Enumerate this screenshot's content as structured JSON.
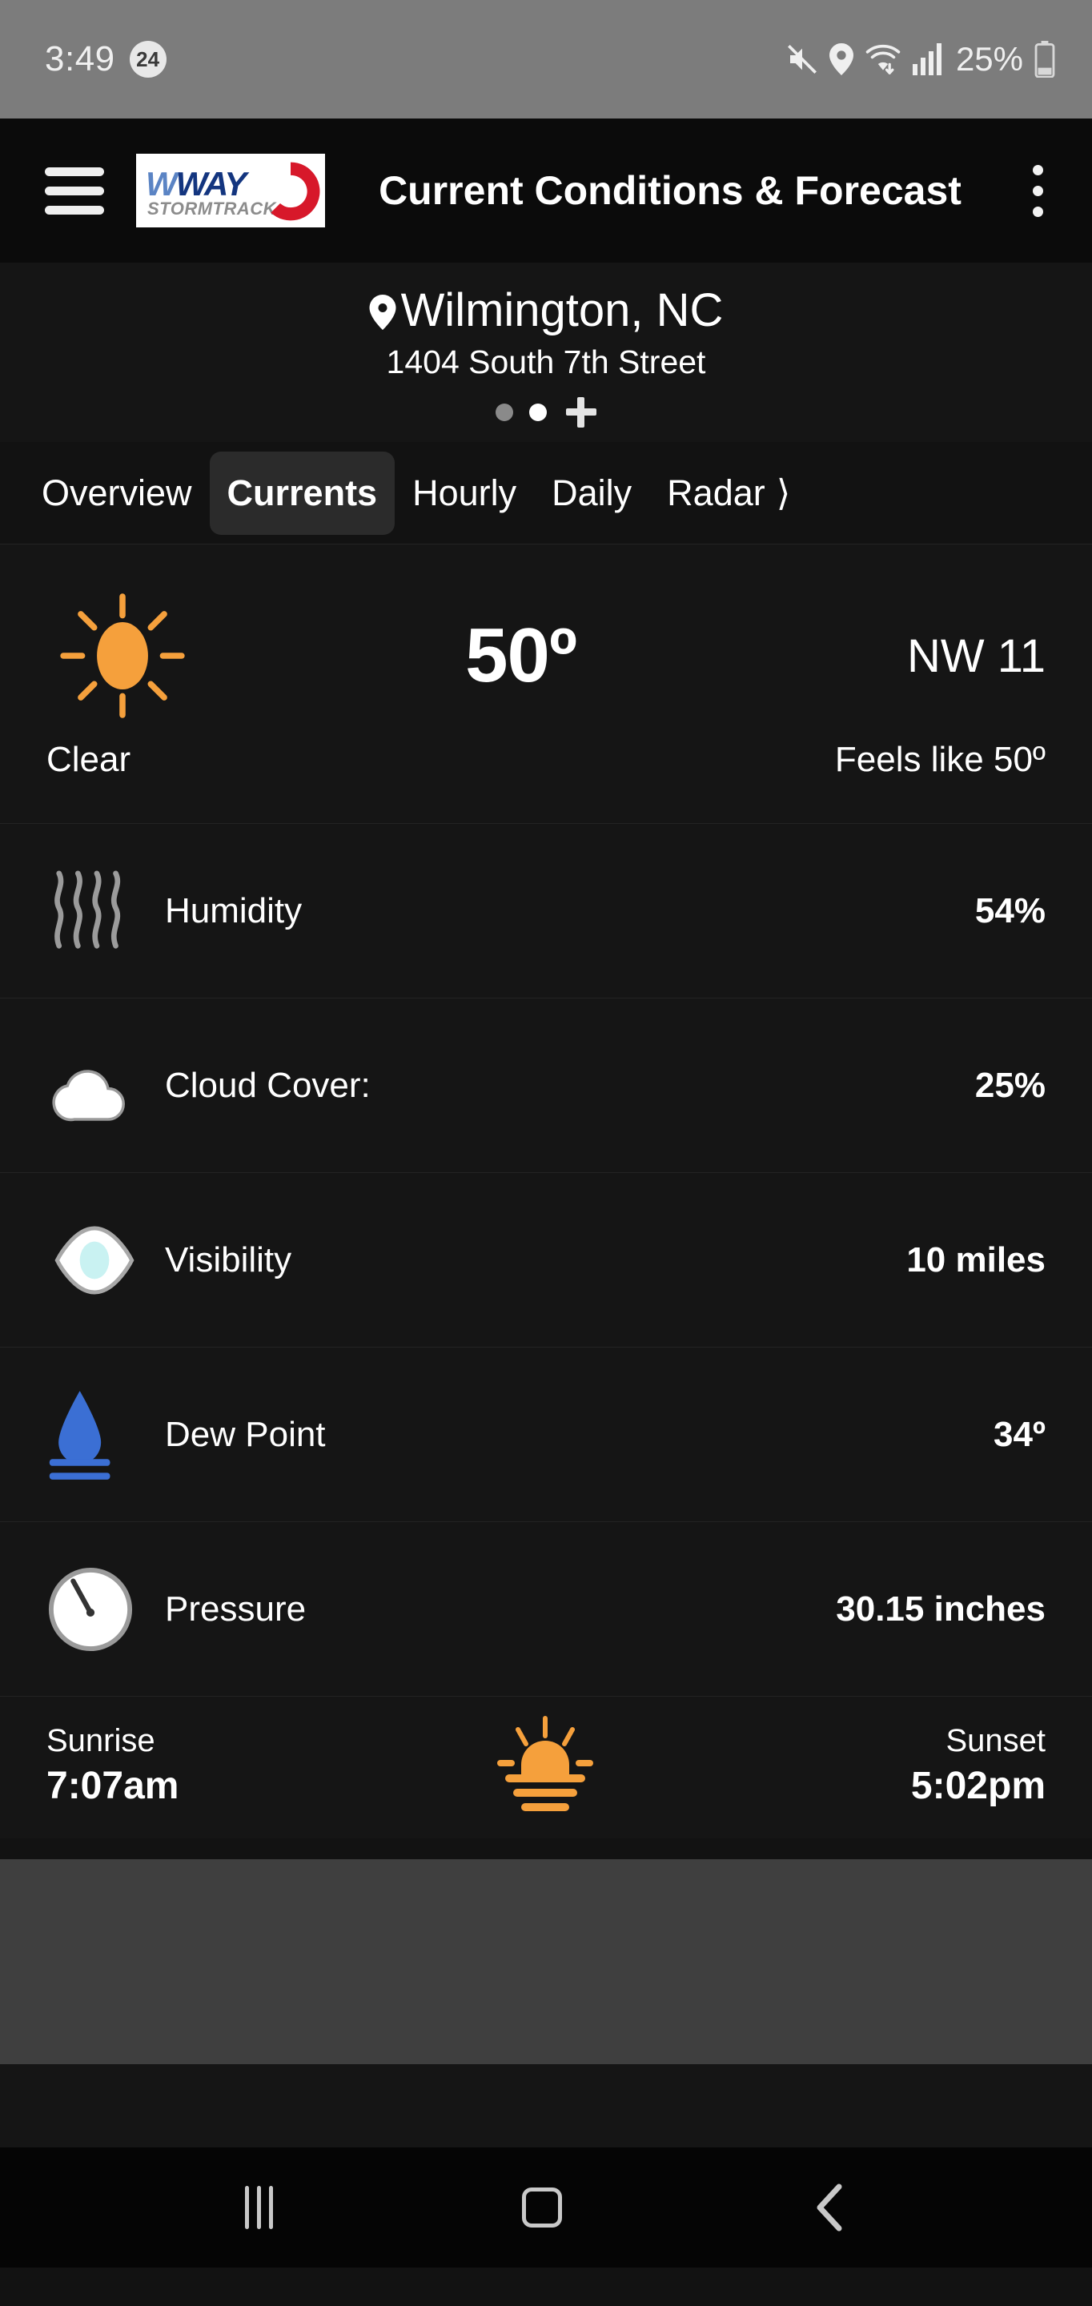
{
  "status_bar": {
    "time": "3:49",
    "notification_count": "24",
    "battery_percent": "25%",
    "icons": [
      "mute-icon",
      "location-icon",
      "wifi-icon",
      "signal-icon",
      "battery-icon"
    ]
  },
  "app_bar": {
    "menu_icon": "hamburger-icon",
    "logo": {
      "brand": "WWAY",
      "brand_first_letter": "W",
      "brand_rest": "WAY",
      "subtitle": "STORMTRACK",
      "channel": "3"
    },
    "title": "Current Conditions & Forecast",
    "overflow_icon": "kebab-menu-icon"
  },
  "location": {
    "city": "Wilmington, NC",
    "address": "1404 South 7th Street",
    "page_dots": [
      "inactive",
      "active"
    ],
    "add_label": "+"
  },
  "tabs": [
    {
      "label": "Overview",
      "active": false
    },
    {
      "label": "Currents",
      "active": true
    },
    {
      "label": "Hourly",
      "active": false
    },
    {
      "label": "Daily",
      "active": false
    },
    {
      "label": "Radar",
      "active": false
    }
  ],
  "tabs_more_icon": "chevron-right-icon",
  "current": {
    "condition_icon": "sun-icon",
    "temperature": "50º",
    "wind": "NW  11",
    "condition": "Clear",
    "feels_like": "Feels like 50º"
  },
  "details": [
    {
      "icon": "humidity-waves-icon",
      "label": "Humidity",
      "value": "54%"
    },
    {
      "icon": "cloud-icon",
      "label": "Cloud Cover:",
      "value": "25%"
    },
    {
      "icon": "eye-icon",
      "label": "Visibility",
      "value": "10 miles"
    },
    {
      "icon": "water-drop-icon",
      "label": "Dew Point",
      "value": "34º"
    },
    {
      "icon": "gauge-icon",
      "label": "Pressure",
      "value": "30.15 inches"
    }
  ],
  "sun": {
    "sunrise_label": "Sunrise",
    "sunrise_time": "7:07am",
    "icon": "sunrise-icon",
    "sunset_label": "Sunset",
    "sunset_time": "5:02pm"
  },
  "nav_bar": {
    "recents_icon": "recents-icon",
    "home_icon": "home-icon",
    "back_icon": "back-icon"
  },
  "colors": {
    "accent_orange": "#f5a03c",
    "logo_blue_light": "#5b84c4",
    "logo_blue_dark": "#13357f",
    "logo_red": "#d7182a",
    "dew_blue": "#3b6fd4",
    "eye_cyan": "#c9f2f2",
    "background": "#151212",
    "status_bar_bg": "#7c7c7c"
  }
}
